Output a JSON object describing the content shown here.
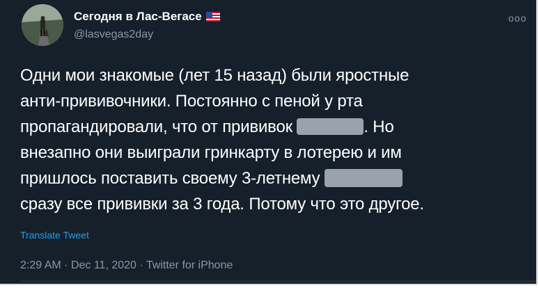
{
  "tweet": {
    "author": {
      "display_name": "Сегодня в Лас-Вегасе",
      "flag_icon": "us-flag-icon",
      "handle": "@lasvegas2day"
    },
    "more_icon": "ooo",
    "text_lines": [
      "Одни мои знакомые (лет 15 назад) были яростные",
      "анти-прививочники. Постоянно с пеной у рта",
      "пропагандировали, что от прививок",
      ". Но",
      "внезапно они выиграли гринкарту в лотерею и им",
      "пришлось поставить своему 3-летнему",
      "сразу все прививки за 3 года. Потому что это другое."
    ],
    "translate_label": "Translate Tweet",
    "time": "2:29 AM",
    "separator": "·",
    "date": "Dec 11, 2020",
    "source": "Twitter for iPhone"
  },
  "colors": {
    "background": "#15202b",
    "text": "#ffffff",
    "muted": "#8899a6",
    "link": "#1da1f2"
  }
}
